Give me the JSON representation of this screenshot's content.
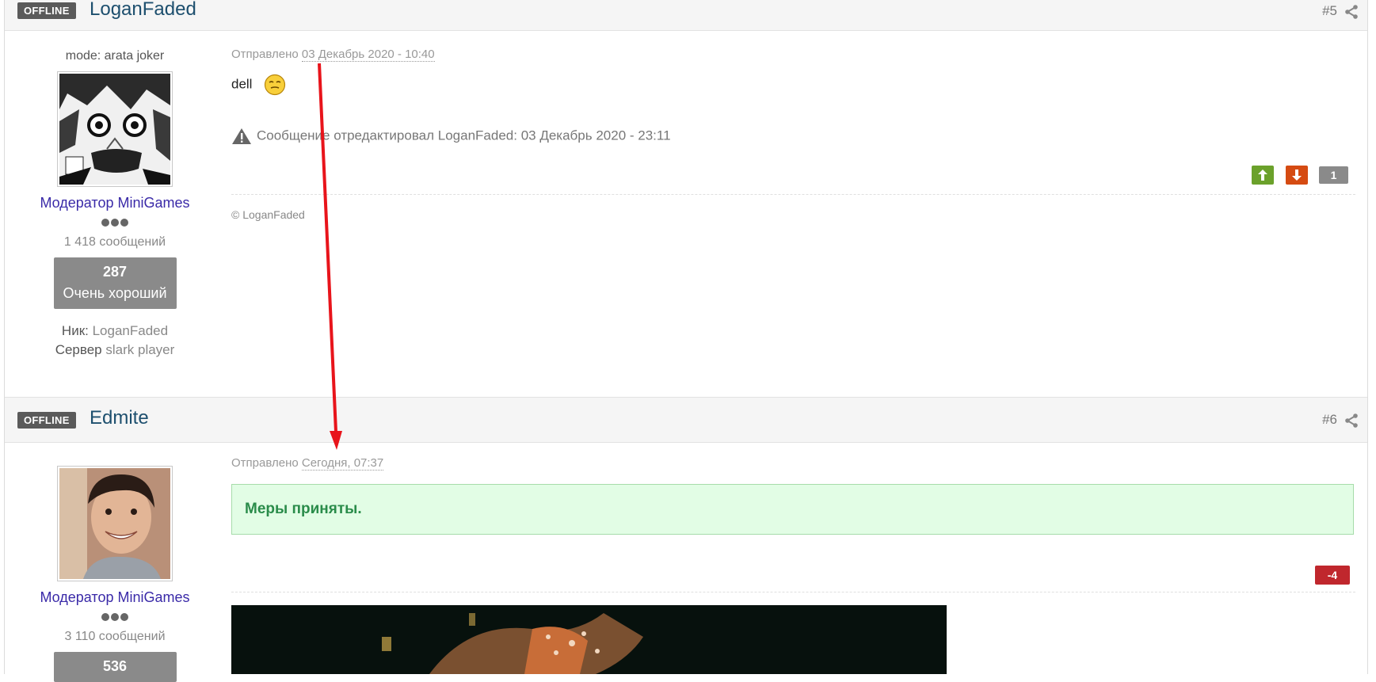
{
  "posts": [
    {
      "status": "OFFLINE",
      "author": "LoganFaded",
      "number": "#5",
      "user_title": "mode: arata joker",
      "group": "Модератор MiniGames",
      "post_count": "1 418 сообщений",
      "reputation_value": "287",
      "reputation_label": "Очень хороший",
      "nick_label": "Ник:",
      "nick_value": "LoganFaded",
      "server_label": "Сервер",
      "server_value": "slark player",
      "posted_label": "Отправлено",
      "posted_date": "03 Декабрь 2020 - 10:40",
      "body": "dell",
      "edited_note": "Сообщение отредактировал LoganFaded: 03 Декабрь 2020 - 23:11",
      "rep_count": "1",
      "signature": "© LoganFaded"
    },
    {
      "status": "OFFLINE",
      "author": "Edmite",
      "number": "#6",
      "group": "Модератор MiniGames",
      "post_count": "3 110 сообщений",
      "reputation_value": "536",
      "posted_label": "Отправлено",
      "posted_date": "Сегодня, 07:37",
      "body": "Меры приняты.",
      "rep_count": "-4"
    }
  ],
  "colors": {
    "offline_badge": "#5a5a5a",
    "author_link": "#1d4f6e",
    "group": "#3a2aa8",
    "vote_up": "#6ba12b",
    "vote_down": "#d54b12",
    "rep_negative": "#c0272d",
    "success_box": "#e2fde5",
    "annotation_arrow": "#e8141b"
  },
  "icons": [
    "share-icon",
    "warning-icon",
    "arrow-up-icon",
    "arrow-down-icon",
    "smiley-icon"
  ]
}
